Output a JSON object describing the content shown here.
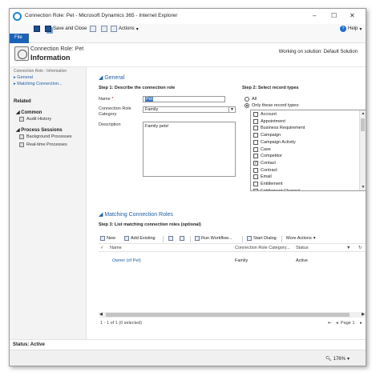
{
  "window": {
    "title": "Connection Role: Pet - Microsoft Dynamics 365 - Internet Explorer",
    "minimize": "–",
    "maximize": "☐",
    "close": "✕"
  },
  "ribbon": {
    "file_label": "File",
    "save_close_label": "Save and Close",
    "actions_label": "Actions",
    "help_label": "Help"
  },
  "header": {
    "entity_label": "Connection Role: Pet",
    "form_title": "Information",
    "solution_text": "Working on solution: Default Solution"
  },
  "left_nav": {
    "breadcrumb": "Connection Role : Information",
    "links": [
      "General",
      "Matching Connection..."
    ],
    "related_heading": "Related",
    "common_heading": "Common",
    "common_items": [
      "Audit History"
    ],
    "process_heading": "Process Sessions",
    "process_items": [
      "Background Processes",
      "Real-time Processes"
    ]
  },
  "general": {
    "section_title": "General",
    "step1": "Step 1: Describe the connection role",
    "name_label": "Name",
    "required_marker": "*",
    "name_value": "Pet",
    "category_label": "Connection Role Category",
    "category_value": "Family",
    "description_label": "Description",
    "description_value": "Family pets!"
  },
  "record_types": {
    "step2": "Step 2: Select record types",
    "all_label": "All",
    "only_label": "Only these record types:",
    "items": [
      {
        "label": "Account",
        "checked": false
      },
      {
        "label": "Appointment",
        "checked": false
      },
      {
        "label": "Business Requirement",
        "checked": false
      },
      {
        "label": "Campaign",
        "checked": false
      },
      {
        "label": "Campaign Activity",
        "checked": false
      },
      {
        "label": "Case",
        "checked": false
      },
      {
        "label": "Competitor",
        "checked": false
      },
      {
        "label": "Contact",
        "checked": true
      },
      {
        "label": "Contract",
        "checked": false
      },
      {
        "label": "Email",
        "checked": false
      },
      {
        "label": "Entitlement",
        "checked": false
      },
      {
        "label": "Entitlement Channel",
        "checked": false
      }
    ]
  },
  "matching": {
    "section_title": "Matching Connection Roles",
    "step3": "Step 3: List matching connection roles (optional)",
    "toolbar": {
      "new_label": "New",
      "add_existing_label": "Add Existing",
      "run_workflow_label": "Run Workflow...",
      "start_dialog_label": "Start Dialog",
      "more_actions_label": "More Actions"
    },
    "columns": [
      "Name",
      "Connection Role Category...",
      "Status"
    ],
    "rows": [
      {
        "name": "Owner (of Pet)",
        "category": "Family",
        "status": "Active"
      }
    ],
    "footer_count": "1 - 1 of 1 (0 selected)",
    "page_label": "Page 1"
  },
  "status": {
    "text": "Status: Active"
  },
  "browser": {
    "zoom": "176%"
  }
}
